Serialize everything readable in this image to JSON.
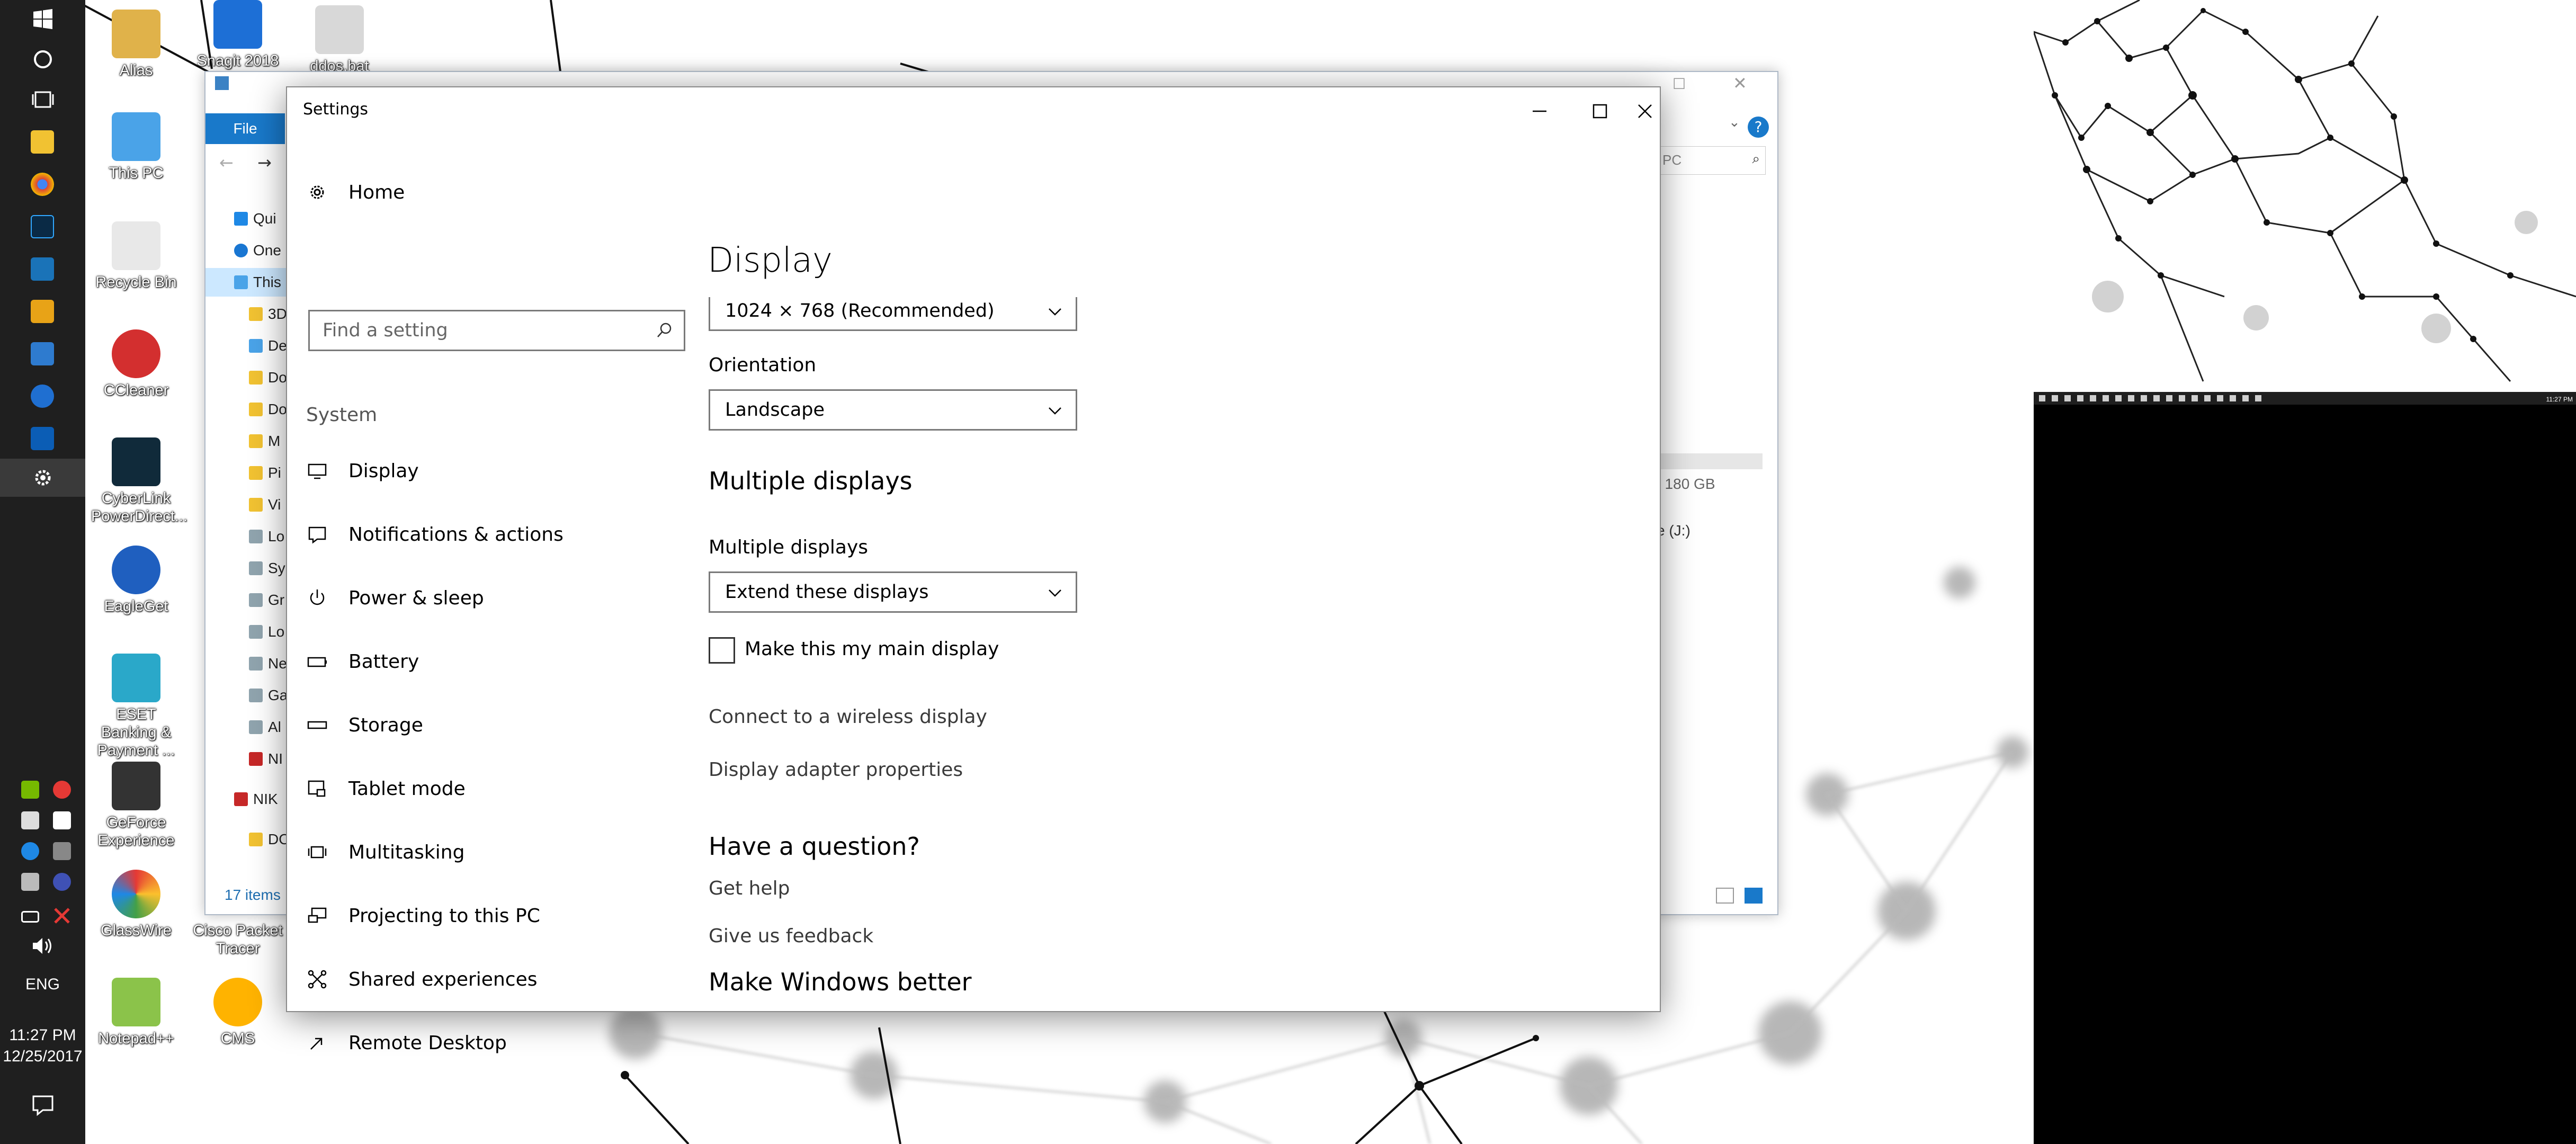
{
  "taskbar": {
    "language": "ENG",
    "time": "11:27 PM",
    "date": "12/25/2017",
    "icons": [
      "windows-start-icon",
      "cortana-circle-icon",
      "task-view-icon",
      "file-explorer-icon",
      "chrome-icon",
      "photoshop-icon",
      "photos-icon",
      "media-player-icon",
      "tool-icon",
      "browser-icon",
      "edge-icon",
      "settings-gear-icon"
    ]
  },
  "desktop": {
    "icons": [
      {
        "label": "Alias"
      },
      {
        "label": "Snagit 2018"
      },
      {
        "label": "ddos.bat"
      },
      {
        "label": "This PC"
      },
      {
        "label": "Recycle Bin"
      },
      {
        "label": "CCleaner"
      },
      {
        "label": "CyberLink PowerDirect..."
      },
      {
        "label": "EagleGet"
      },
      {
        "label": "ESET Banking & Payment ..."
      },
      {
        "label": "GeForce Experience"
      },
      {
        "label": "GlassWire"
      },
      {
        "label": "Cisco Packet Tracer"
      },
      {
        "label": "Notepad++"
      },
      {
        "label": "CMS"
      }
    ]
  },
  "explorer": {
    "file_tab": "File",
    "search_partial": "PC",
    "nav_items": [
      "Qui",
      "One",
      "This",
      "3D",
      "De",
      "Do",
      "Do",
      "M",
      "Pi",
      "Vi",
      "Lo",
      "Sy",
      "Gr",
      "Lo",
      "Ne",
      "Ga",
      "Al",
      "NI",
      "NIK",
      "DO"
    ],
    "status_items": "17 items",
    "drive_size": "f 180 GB",
    "drive_letter": "e (J:)"
  },
  "settings": {
    "title": "Settings",
    "home_label": "Home",
    "search_placeholder": "Find a setting",
    "section_label": "System",
    "nav": [
      {
        "label": "Display",
        "icon": "monitor-icon"
      },
      {
        "label": "Notifications & actions",
        "icon": "notification-icon"
      },
      {
        "label": "Power & sleep",
        "icon": "power-icon"
      },
      {
        "label": "Battery",
        "icon": "battery-icon"
      },
      {
        "label": "Storage",
        "icon": "storage-icon"
      },
      {
        "label": "Tablet mode",
        "icon": "tablet-mode-icon"
      },
      {
        "label": "Multitasking",
        "icon": "multitasking-icon"
      },
      {
        "label": "Projecting to this PC",
        "icon": "projecting-icon"
      },
      {
        "label": "Shared experiences",
        "icon": "shared-experiences-icon"
      },
      {
        "label": "Remote Desktop",
        "icon": "remote-desktop-icon"
      }
    ],
    "content": {
      "page_title": "Display",
      "resolution_value": "1024 × 768 (Recommended)",
      "orientation_label": "Orientation",
      "orientation_value": "Landscape",
      "multiple_displays_heading": "Multiple displays",
      "multiple_displays_label": "Multiple displays",
      "multiple_displays_value": "Extend these displays",
      "main_display_checkbox": "Make this my main display",
      "main_display_checked": false,
      "wireless_link": "Connect to a wireless display",
      "adapter_link": "Display adapter properties",
      "question_heading": "Have a question?",
      "get_help_link": "Get help",
      "better_heading": "Make Windows better",
      "feedback_link": "Give us feedback"
    }
  },
  "monitor2": {
    "time": "11:27 PM"
  }
}
